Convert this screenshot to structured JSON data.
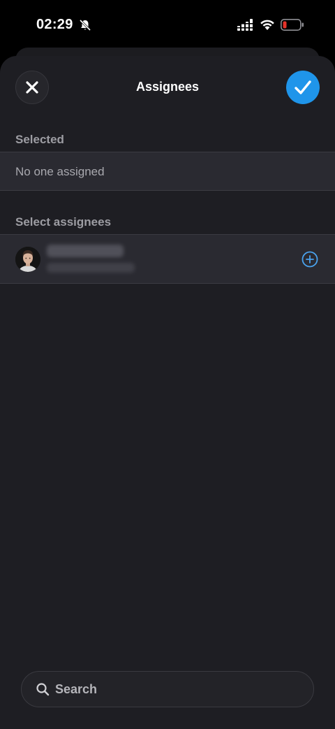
{
  "status_bar": {
    "time": "02:29",
    "battery_color": "#e5332a"
  },
  "header": {
    "title": "Assignees",
    "close_icon": "close-icon",
    "confirm_icon": "checkmark-icon",
    "accent_color": "#1f95ea"
  },
  "selected_section": {
    "label": "Selected",
    "empty_text": "No one assigned"
  },
  "assignees_section": {
    "label": "Select assignees",
    "users": [
      {
        "avatar": "avatar",
        "action_icon": "add-circle-icon"
      }
    ]
  },
  "search": {
    "placeholder": "Search"
  }
}
